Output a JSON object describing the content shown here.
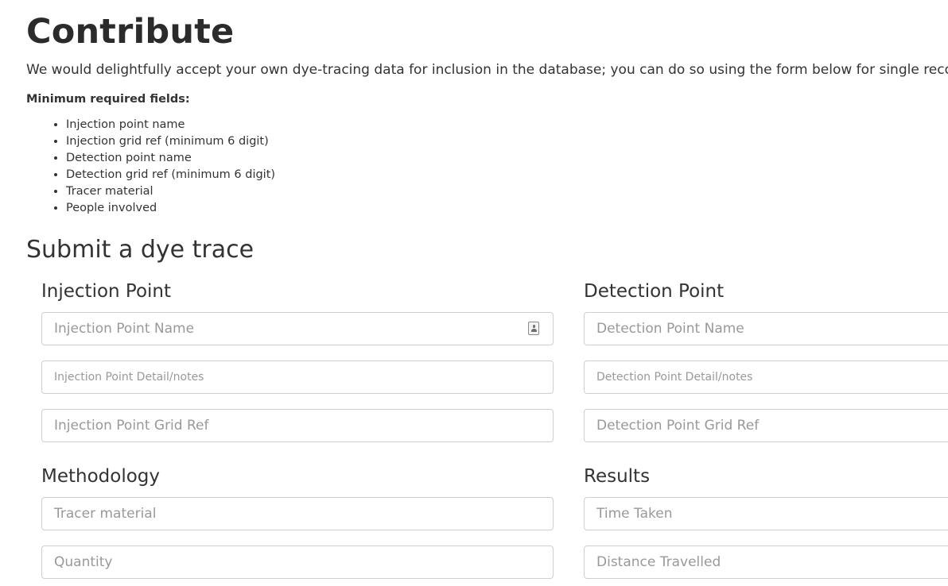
{
  "page": {
    "title": "Contribute",
    "intro": "We would delightfully accept your own dye-tracing data for inclusion in the database; you can do so using the form below for single records, or",
    "required_heading": "Minimum required fields:",
    "required_fields": [
      "Injection point name",
      "Injection grid ref (minimum 6 digit)",
      "Detection point name",
      "Detection grid ref (minimum 6 digit)",
      "Tracer material",
      "People involved"
    ]
  },
  "form": {
    "title": "Submit a dye trace",
    "injection": {
      "title": "Injection Point",
      "name_placeholder": "Injection Point Name",
      "detail_placeholder": "Injection Point Detail/notes",
      "gridref_placeholder": "Injection Point Grid Ref",
      "name_icon": "contact-card-icon"
    },
    "detection": {
      "title": "Detection Point",
      "name_placeholder": "Detection Point Name",
      "detail_placeholder": "Detection Point Detail/notes",
      "gridref_placeholder": "Detection Point Grid Ref"
    },
    "methodology": {
      "title": "Methodology",
      "tracer_placeholder": "Tracer material",
      "quantity_placeholder": "Quantity"
    },
    "results": {
      "title": "Results",
      "time_placeholder": "Time Taken",
      "distance_placeholder": "Distance Travelled"
    }
  },
  "colors": {
    "text": "#333333",
    "border": "#cfcfcf",
    "placeholder": "#999999",
    "background": "#ffffff"
  }
}
